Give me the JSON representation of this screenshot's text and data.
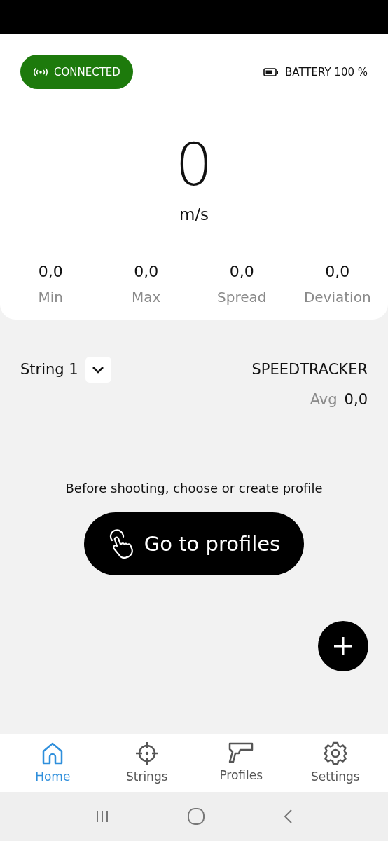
{
  "connection": {
    "label": "CONNECTED",
    "connected": true
  },
  "battery": {
    "label": "BATTERY 100 %"
  },
  "speed": {
    "value": "0",
    "unit": "m/s"
  },
  "stats": [
    {
      "value": "0,0",
      "label": "Min"
    },
    {
      "value": "0,0",
      "label": "Max"
    },
    {
      "value": "0,0",
      "label": "Spread"
    },
    {
      "value": "0,0",
      "label": "Deviation"
    }
  ],
  "string": {
    "label": "String 1"
  },
  "device": {
    "name": "SPEEDTRACKER",
    "avg_label": "Avg",
    "avg_value": "0,0"
  },
  "prompt": {
    "text": "Before shooting, choose or create profile",
    "button": "Go to profiles"
  },
  "nav": [
    {
      "kind": "home",
      "label": "Home",
      "selected": true
    },
    {
      "kind": "target",
      "label": "Strings",
      "selected": false
    },
    {
      "kind": "pistol",
      "label": "Profiles",
      "selected": false
    },
    {
      "kind": "gear",
      "label": "Settings",
      "selected": false
    }
  ]
}
